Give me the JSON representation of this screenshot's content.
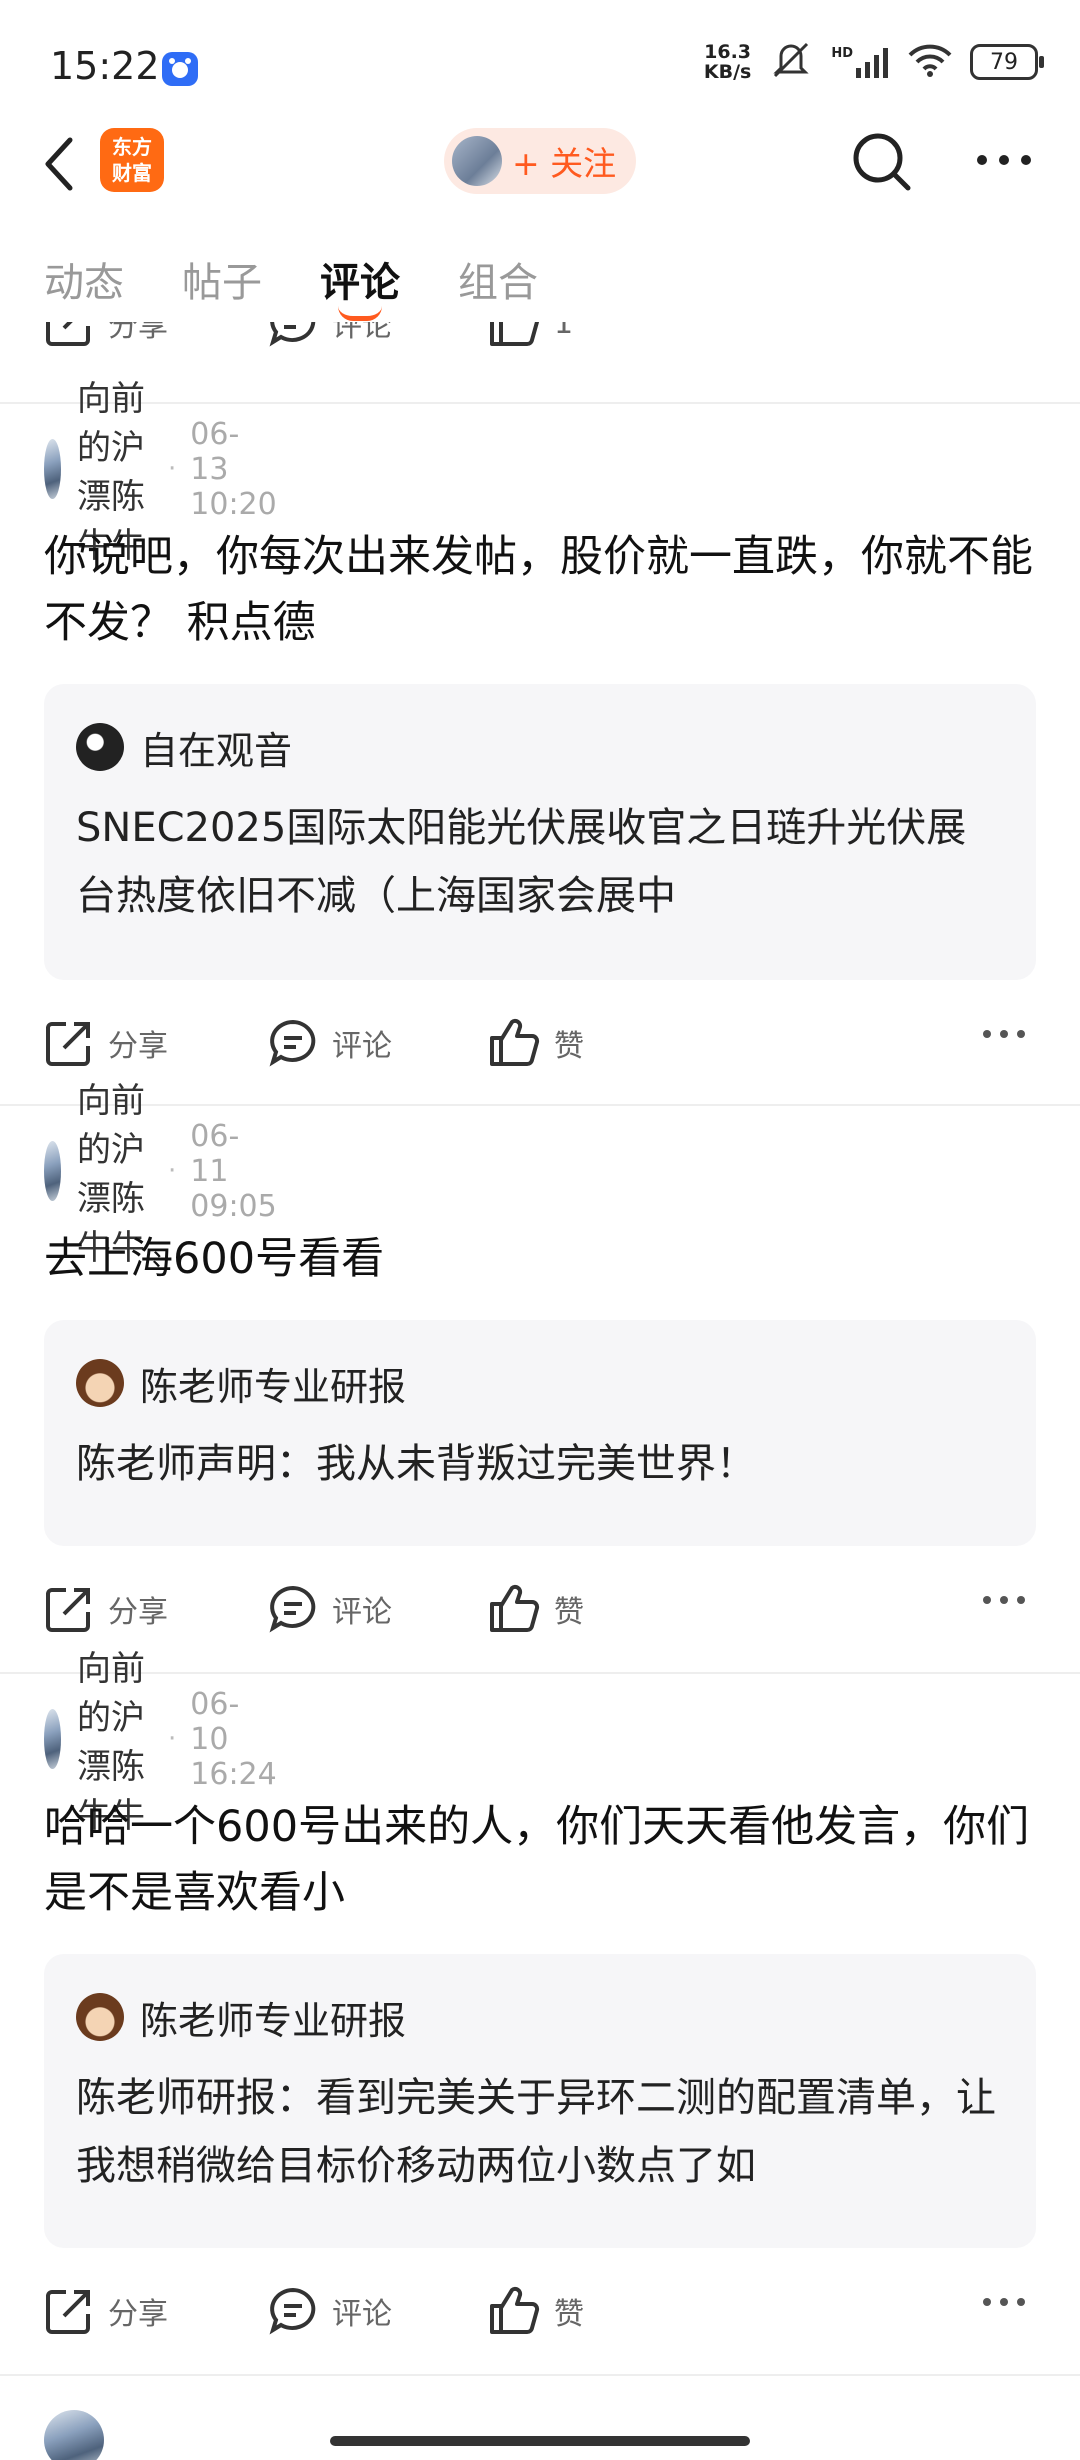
{
  "status_bar": {
    "time": "15:22",
    "net_speed": "16.3\nKB/s",
    "hd": "HD",
    "battery": "79"
  },
  "header": {
    "logo_text": "东方财富",
    "follow_label": "+ 关注"
  },
  "tabs": [
    {
      "label": "动态",
      "active": false
    },
    {
      "label": "帖子",
      "active": false
    },
    {
      "label": "评论",
      "active": true
    },
    {
      "label": "组合",
      "active": false
    }
  ],
  "action_labels": {
    "share": "分享",
    "comment": "评论",
    "like": "赞",
    "like_count_top": "1"
  },
  "posts": [
    {
      "author": "向前的沪漂陈牛牛",
      "time": "06-13 10:20",
      "text": "你说吧，你每次出来发帖，股价就一直跌，你就不能不发？  积点德",
      "quote": {
        "author": "自在观音",
        "text": "SNEC2025国际太阳能光伏展收官之日琏升光伏展台热度依旧不减（上海国家会展中"
      }
    },
    {
      "author": "向前的沪漂陈牛牛",
      "time": "06-11 09:05",
      "text": "去上海600号看看",
      "quote": {
        "author": "陈老师专业研报",
        "text": "陈老师声明：我从未背叛过完美世界！"
      }
    },
    {
      "author": "向前的沪漂陈牛牛",
      "time": "06-10 16:24",
      "text": "哈哈一个600号出来的人，你们天天看他发言，你们是不是喜欢看小",
      "quote": {
        "author": "陈老师专业研报",
        "text": "陈老师研报：看到完美关于异环二测的配置清单，让我想稍微给目标价移动两位小数点了如"
      }
    }
  ],
  "colors": {
    "accent": "#ff5a1f",
    "logo": "#ff6a13",
    "quote_bg": "#f6f6f8"
  }
}
